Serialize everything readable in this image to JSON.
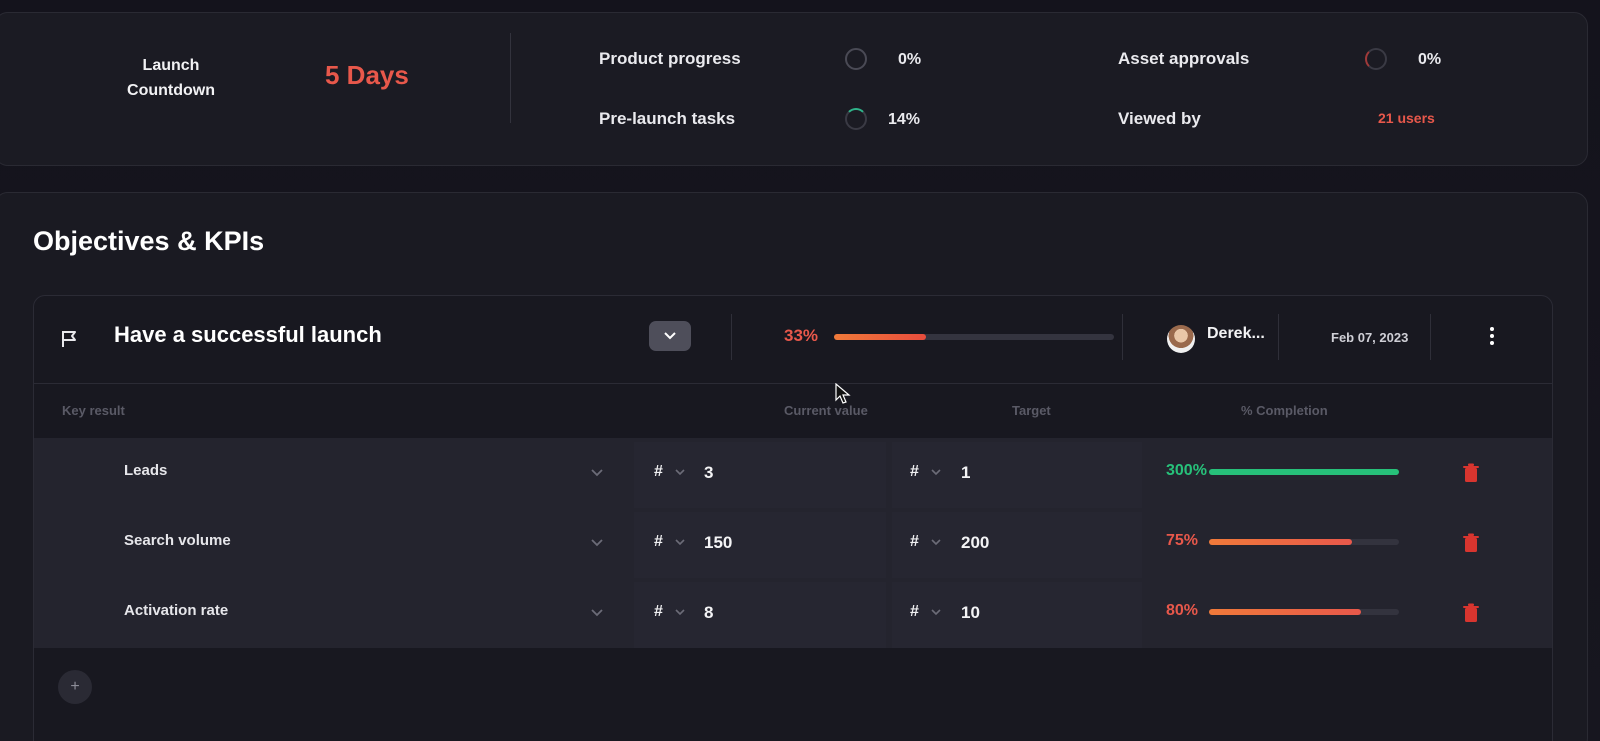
{
  "summary": {
    "countdown_label": "Launch Countdown",
    "countdown_value": "5 Days",
    "metrics": [
      {
        "label": "Product progress",
        "value": "0%"
      },
      {
        "label": "Pre-launch tasks",
        "value": "14%"
      },
      {
        "label": "Asset approvals",
        "value": "0%"
      }
    ],
    "viewed_label": "Viewed by",
    "viewed_value": "21 users"
  },
  "section_title": "Objectives & KPIs",
  "objective": {
    "title": "Have a successful launch",
    "progress_label": "33%",
    "progress_fraction": 0.33,
    "owner": "Derek...",
    "date": "Feb 07, 2023"
  },
  "columns": {
    "key_result": "Key result",
    "current_value": "Current value",
    "target": "Target",
    "completion": "% Completion"
  },
  "key_results": [
    {
      "name": "Leads",
      "current_unit": "#",
      "current": "3",
      "target_unit": "#",
      "target": "1",
      "completion_label": "300%",
      "completion_fraction": 1.0,
      "status": "over"
    },
    {
      "name": "Search volume",
      "current_unit": "#",
      "current": "150",
      "target_unit": "#",
      "target": "200",
      "completion_label": "75%",
      "completion_fraction": 0.75,
      "status": "partial"
    },
    {
      "name": "Activation rate",
      "current_unit": "#",
      "current": "8",
      "target_unit": "#",
      "target": "10",
      "completion_label": "80%",
      "completion_fraction": 0.8,
      "status": "partial"
    }
  ],
  "add_button": "+",
  "colors": {
    "accent_red": "#e8584b",
    "success_green": "#27c17a",
    "bar_orange": "#f07a3a"
  }
}
